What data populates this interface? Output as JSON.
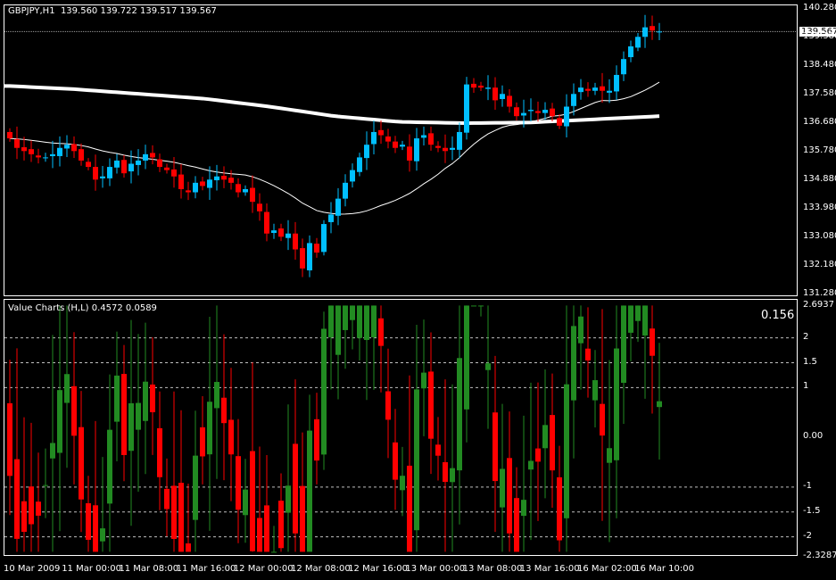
{
  "header": {
    "symbol": "GBPJPY,H1",
    "ohlc": "139.560 139.722 139.517 139.567"
  },
  "indicator": {
    "title": "Value Charts (H,L) 0.4572 0.0589",
    "value": "0.156"
  },
  "price_axis": [
    "140.280",
    "139.380",
    "138.480",
    "137.580",
    "136.680",
    "135.780",
    "134.880",
    "133.980",
    "133.080",
    "132.180",
    "131.280"
  ],
  "current_price": "139.567",
  "indicator_axis": [
    {
      "label": "2.6937",
      "v": 2.6937
    },
    {
      "label": "2",
      "v": 2
    },
    {
      "label": "1.5",
      "v": 1.5
    },
    {
      "label": "1",
      "v": 1
    },
    {
      "label": "0.00",
      "v": 0
    },
    {
      "label": "-1",
      "v": -1
    },
    {
      "label": "-1.5",
      "v": -1.5
    },
    {
      "label": "-2",
      "v": -2
    },
    {
      "label": "-2.3287",
      "v": -2.3287
    }
  ],
  "time_axis": [
    "10 Mar 2009",
    "11 Mar 00:00",
    "11 Mar 08:00",
    "11 Mar 16:00",
    "12 Mar 00:00",
    "12 Mar 08:00",
    "12 Mar 16:00",
    "13 Mar 00:00",
    "13 Mar 08:00",
    "13 Mar 16:00",
    "16 Mar 02:00",
    "16 Mar 10:00"
  ],
  "colors": {
    "bull": "#00bfff",
    "bear": "#ff0000",
    "vc_up": "#228b22",
    "vc_down": "#ff0000",
    "ma": "#ffffff",
    "grid": "#c0c0c0"
  },
  "chart_data": {
    "type": "candlestick",
    "price_range": [
      131.28,
      140.28
    ],
    "closes": [
      136.2,
      135.9,
      135.8,
      135.7,
      135.6,
      135.6,
      135.7,
      135.9,
      136.0,
      135.8,
      135.5,
      135.3,
      134.9,
      135.0,
      135.3,
      135.5,
      135.1,
      135.4,
      135.5,
      135.7,
      135.6,
      135.3,
      135.2,
      135.0,
      134.6,
      134.5,
      134.8,
      134.7,
      134.9,
      135.0,
      134.9,
      134.8,
      134.5,
      134.6,
      134.2,
      133.9,
      133.2,
      133.3,
      133.1,
      133.2,
      132.7,
      132.1,
      132.9,
      132.6,
      133.5,
      133.8,
      134.3,
      134.8,
      135.2,
      135.6,
      136.0,
      136.4,
      136.3,
      136.1,
      135.9,
      136.0,
      135.5,
      136.2,
      136.3,
      136.0,
      135.9,
      135.8,
      135.9,
      136.4,
      137.9,
      137.8,
      137.8,
      137.8,
      137.4,
      137.6,
      137.2,
      136.9,
      137.0,
      137.1,
      137.0,
      137.1,
      136.9,
      136.6,
      137.2,
      137.6,
      137.8,
      137.7,
      137.8,
      137.7,
      137.7,
      138.2,
      138.7,
      139.1,
      139.4,
      139.7,
      139.6,
      139.567
    ],
    "slow_ma": [
      137.85,
      137.75,
      137.6,
      137.45,
      137.2,
      136.9,
      136.72,
      136.68,
      136.7,
      136.8,
      136.9
    ],
    "indicator_range": [
      -2.3287,
      2.6937
    ],
    "indicator_levels": [
      2,
      1.5,
      1,
      -1,
      -1.5,
      -2
    ]
  }
}
